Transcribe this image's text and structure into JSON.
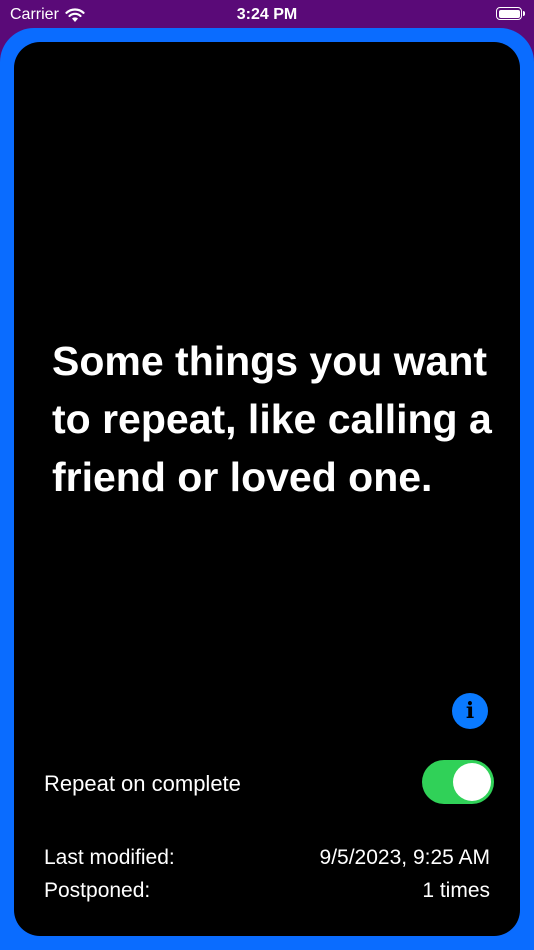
{
  "status_bar": {
    "carrier": "Carrier",
    "time": "3:24 PM",
    "icons": [
      "wifi-icon",
      "battery-icon"
    ]
  },
  "colors": {
    "frame": "#0a6cff",
    "background": "#5a0a78",
    "card": "#000000",
    "toggle_on": "#30d158",
    "info_button": "#0a7aff"
  },
  "card": {
    "headline": "Some things you want to repeat, like calling a friend or loved one.",
    "info_icon": "info-circle-icon",
    "repeat": {
      "label": "Repeat on complete",
      "enabled": true
    },
    "meta": {
      "last_modified_label": "Last modified:",
      "last_modified_value": "9/5/2023, 9:25 AM",
      "postponed_label": "Postponed:",
      "postponed_value": "1 times"
    }
  }
}
